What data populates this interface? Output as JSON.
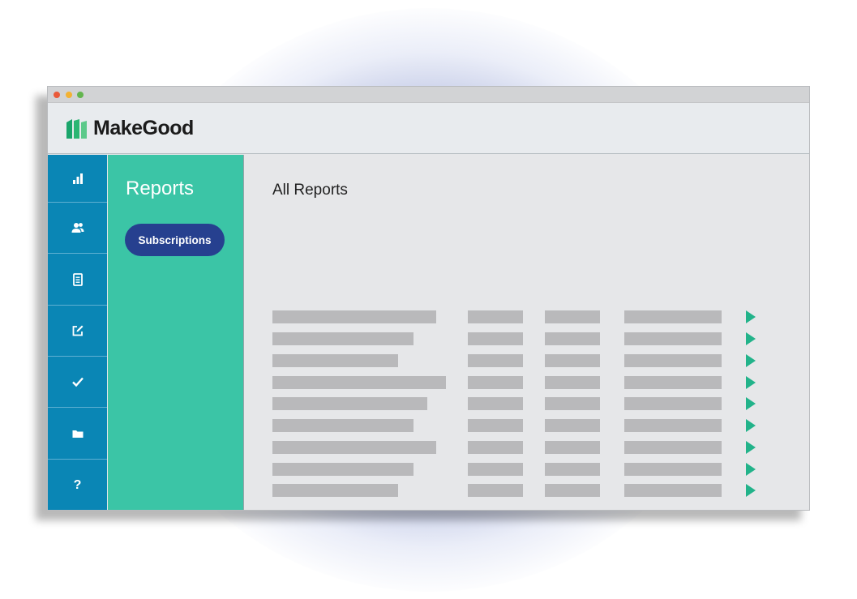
{
  "app": {
    "brand": "MakeGood",
    "brand_color": "#1b1b1b",
    "logo_color": "#2bb673"
  },
  "sidebar": {
    "icons": [
      {
        "icon": "bar-chart-icon"
      },
      {
        "icon": "users-icon"
      },
      {
        "icon": "document-icon"
      },
      {
        "icon": "edit-icon"
      },
      {
        "icon": "checkmark-icon"
      },
      {
        "icon": "folder-icon"
      },
      {
        "icon": "help-icon",
        "glyph": "?"
      }
    ],
    "color": "#0a86b5"
  },
  "subnav": {
    "title": "Reports",
    "button_label": "Subscriptions",
    "color": "#3bc5a6",
    "button_color": "#26408f"
  },
  "main": {
    "title": "All Reports",
    "row_count": 9,
    "placeholder_color": "#b9b9bb",
    "play_icon": "play-icon",
    "play_color": "#22b38a"
  }
}
